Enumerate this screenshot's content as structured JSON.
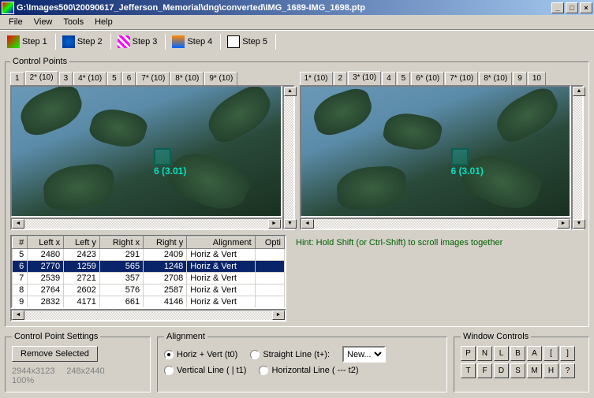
{
  "window": {
    "title": "G:\\Images500\\20090617_Jefferson_Memorial\\dng\\converted\\IMG_1689-IMG_1698.ptp",
    "minimize": "_",
    "maximize": "□",
    "close": "×"
  },
  "menu": {
    "file": "File",
    "view": "View",
    "tools": "Tools",
    "help": "Help"
  },
  "steps": {
    "s1": "Step 1",
    "s2": "Step 2",
    "s3": "Step 3",
    "s4": "Step 4",
    "s5": "Step 5"
  },
  "cp_group": "Control Points",
  "left_tabs": [
    "1",
    "2* (10)",
    "3",
    "4* (10)",
    "5",
    "6",
    "7* (10)",
    "8* (10)",
    "9* (10)"
  ],
  "left_active": 1,
  "right_tabs": [
    "1* (10)",
    "2",
    "3* (10)",
    "4",
    "5",
    "6* (10)",
    "7* (10)",
    "8* (10)",
    "9",
    "10"
  ],
  "right_active": 2,
  "marker_label": "6 (3.01)",
  "table": {
    "headers": [
      "#",
      "Left x",
      "Left y",
      "Right x",
      "Right y",
      "Alignment",
      "Opti"
    ],
    "rows": [
      {
        "n": "5",
        "lx": "2480",
        "ly": "2423",
        "rx": "291",
        "ry": "2409",
        "al": "Horiz & Vert"
      },
      {
        "n": "6",
        "lx": "2770",
        "ly": "1259",
        "rx": "565",
        "ry": "1248",
        "al": "Horiz & Vert"
      },
      {
        "n": "7",
        "lx": "2539",
        "ly": "2721",
        "rx": "357",
        "ry": "2708",
        "al": "Horiz & Vert"
      },
      {
        "n": "8",
        "lx": "2764",
        "ly": "2602",
        "rx": "576",
        "ry": "2587",
        "al": "Horiz & Vert"
      },
      {
        "n": "9",
        "lx": "2832",
        "ly": "4171",
        "rx": "661",
        "ry": "4146",
        "al": "Horiz & Vert"
      }
    ],
    "selected": 1
  },
  "hint": "Hint: Hold Shift (or Ctrl-Shift) to scroll images together",
  "cps": {
    "legend": "Control Point Settings",
    "remove": "Remove Selected",
    "dim1": "2944x3123",
    "dim2": "248x2440",
    "zoom": "100%"
  },
  "align": {
    "legend": "Alignment",
    "hv": "Horiz + Vert (t0)",
    "sl": "Straight Line (t+):",
    "vl": "Vertical Line ( | t1)",
    "hl": "Horizontal Line ( --- t2)",
    "combo": "New..."
  },
  "wc": {
    "legend": "Window Controls",
    "row1": [
      "P",
      "N",
      "L",
      "B",
      "A",
      "[",
      "]"
    ],
    "row2": [
      "T",
      "F",
      "D",
      "S",
      "M",
      "H",
      "?"
    ]
  }
}
